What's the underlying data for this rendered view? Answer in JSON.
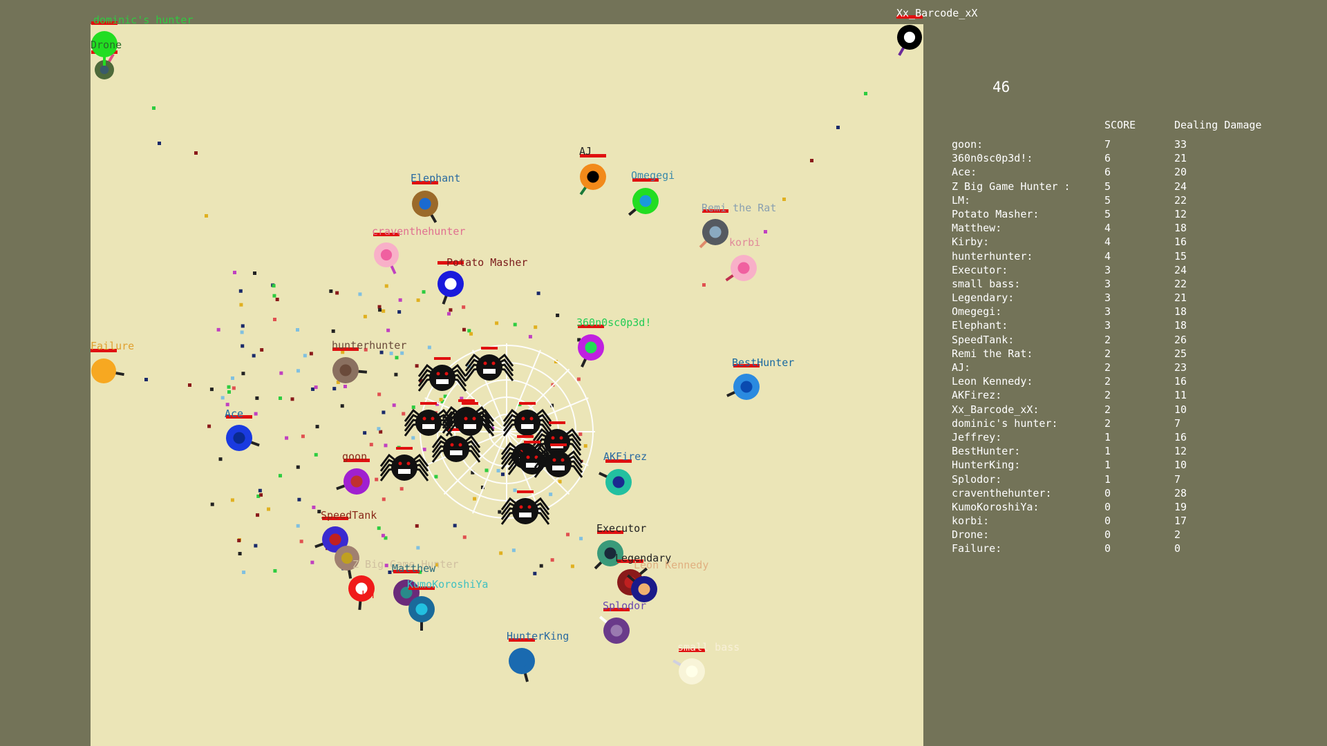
{
  "timer": "46",
  "scoreboard": {
    "headers": {
      "score": "SCORE",
      "damage": "Dealing Damage"
    },
    "rows": [
      {
        "name": "goon:",
        "score": "7",
        "damage": "33"
      },
      {
        "name": "360n0sc0p3d!:",
        "score": "6",
        "damage": "21"
      },
      {
        "name": "Ace:",
        "score": "6",
        "damage": "20"
      },
      {
        "name": "Z Big Game Hunter :",
        "score": "5",
        "damage": "24"
      },
      {
        "name": "LM:",
        "score": "5",
        "damage": "22"
      },
      {
        "name": "Potato Masher:",
        "score": "5",
        "damage": "12"
      },
      {
        "name": "Matthew:",
        "score": "4",
        "damage": "18"
      },
      {
        "name": "Kirby:",
        "score": "4",
        "damage": "16"
      },
      {
        "name": "hunterhunter:",
        "score": "4",
        "damage": "15"
      },
      {
        "name": "Executor:",
        "score": "3",
        "damage": "24"
      },
      {
        "name": "small bass:",
        "score": "3",
        "damage": "22"
      },
      {
        "name": "Legendary:",
        "score": "3",
        "damage": "21"
      },
      {
        "name": "Omegegi:",
        "score": "3",
        "damage": "18"
      },
      {
        "name": "Elephant:",
        "score": "3",
        "damage": "18"
      },
      {
        "name": "SpeedTank:",
        "score": "2",
        "damage": "26"
      },
      {
        "name": "Remi the Rat:",
        "score": "2",
        "damage": "25"
      },
      {
        "name": "AJ:",
        "score": "2",
        "damage": "23"
      },
      {
        "name": "Leon Kennedy:",
        "score": "2",
        "damage": "16"
      },
      {
        "name": "AKFirez:",
        "score": "2",
        "damage": "11"
      },
      {
        "name": "Xx_Barcode_xX:",
        "score": "2",
        "damage": "10"
      },
      {
        "name": "dominic's hunter:",
        "score": "2",
        "damage": "7"
      },
      {
        "name": "Jeffrey:",
        "score": "1",
        "damage": "16"
      },
      {
        "name": "BestHunter:",
        "score": "1",
        "damage": "12"
      },
      {
        "name": "HunterKing:",
        "score": "1",
        "damage": "10"
      },
      {
        "name": "Splodor:",
        "score": "1",
        "damage": "7"
      },
      {
        "name": "craventhehunter:",
        "score": "0",
        "damage": "28"
      },
      {
        "name": "KumoKoroshiYa:",
        "score": "0",
        "damage": "19"
      },
      {
        "name": "korbi:",
        "score": "0",
        "damage": "17"
      },
      {
        "name": "Drone:",
        "score": "0",
        "damage": "2"
      },
      {
        "name": "Failure:",
        "score": "0",
        "damage": "0"
      }
    ]
  },
  "players": [
    {
      "name": "dominic's hunter",
      "body": "#4e6a3a",
      "core": "#3a5a6a",
      "barrel": "#e05080",
      "label_color": "#2ecc40"
    },
    {
      "name": "Drone",
      "body": "#22dd22",
      "core": "#22dd22",
      "barrel": "#22dd22",
      "label_color": "#2a6a2a"
    },
    {
      "name": "Xx_Barcode_xX",
      "body": "#000000",
      "core": "#ffffff",
      "barrel": "#6a2a9a",
      "label_color": "#ffffff"
    },
    {
      "name": "AJ",
      "body": "#f28a1a",
      "core": "#000000",
      "barrel": "#1a7a3a",
      "label_color": "#222222"
    },
    {
      "name": "Elephant",
      "body": "#9b6a2a",
      "core": "#1a6ad0",
      "barrel": "#222222",
      "label_color": "#2a6aa0"
    },
    {
      "name": "Omegegi",
      "body": "#22dd22",
      "core": "#1a9adc",
      "barrel": "#222222",
      "label_color": "#3a8aaa"
    },
    {
      "name": "Remi the Rat",
      "body": "#555a60",
      "core": "#8aaac0",
      "barrel": "#e08a6a",
      "label_color": "#8aa0b0"
    },
    {
      "name": "craventhehunter",
      "body": "#f8b0c8",
      "core": "#f060a0",
      "barrel": "#c040c0",
      "label_color": "#e07090"
    },
    {
      "name": "korbi",
      "body": "#f8b0c8",
      "core": "#f060a0",
      "barrel": "#c03050",
      "label_color": "#e08a9a"
    },
    {
      "name": "Potato Masher",
      "body": "#1a1adc",
      "core": "#ffffff",
      "barrel": "#222222",
      "label_color": "#7a1a1a"
    },
    {
      "name": "360n0sc0p3d!",
      "body": "#c020e0",
      "core": "#22dd55",
      "barrel": "#222222",
      "label_color": "#22cc55"
    },
    {
      "name": "Failure",
      "body": "#f7a821",
      "core": "#f7a821",
      "barrel": "#222222",
      "label_color": "#e0a030"
    },
    {
      "name": "hunterhunter",
      "body": "#8a7060",
      "core": "#6a4a3a",
      "barrel": "#222222",
      "label_color": "#6a4a3a"
    },
    {
      "name": "BestHunter",
      "body": "#2a8ae0",
      "core": "#0a4ab0",
      "barrel": "#222222",
      "label_color": "#1a6aa0"
    },
    {
      "name": "Ace",
      "body": "#1a3ae0",
      "core": "#0a2a90",
      "barrel": "#222222",
      "label_color": "#1a6aa0"
    },
    {
      "name": "goon",
      "body": "#a020d0",
      "core": "#c03030",
      "barrel": "#222222",
      "label_color": "#8a2a1a"
    },
    {
      "name": "AKFirez",
      "body": "#22c0a0",
      "core": "#1a2a90",
      "barrel": "#222222",
      "label_color": "#2a6aa0"
    },
    {
      "name": "SpeedTank",
      "body": "#3a2ad0",
      "core": "#c02020",
      "barrel": "#222222",
      "label_color": "#8a2a1a"
    },
    {
      "name": "Z Big Game Hunter",
      "body": "#a08070",
      "core": "#c0a020",
      "barrel": "#222222",
      "label_color": "#d0c0a0"
    },
    {
      "name": "Executor",
      "body": "#3a9a7a",
      "core": "#1a2a3a",
      "barrel": "#222222",
      "label_color": "#222222"
    },
    {
      "name": "Legendary",
      "body": "#8a1a1a",
      "core": "#c02020",
      "barrel": "#222222",
      "label_color": "#222222"
    },
    {
      "name": "Leon Kennedy",
      "body": "#1a1a8a",
      "core": "#f0b070",
      "barrel": "#222222",
      "label_color": "#e0b080"
    },
    {
      "name": "Matthew",
      "body": "#6a2a7a",
      "core": "#2a8a8a",
      "barrel": "#e0c020",
      "label_color": "#2a6a7a"
    },
    {
      "name": "KumoKoroshiYa",
      "body": "#1a6a9a",
      "core": "#22c0e0",
      "barrel": "#222222",
      "label_color": "#40c0c0"
    },
    {
      "name": "LM",
      "body": "#f01a1a",
      "core": "#ffffff",
      "barrel": "#222222",
      "label_color": "#f01a1a"
    },
    {
      "name": "Splodor",
      "body": "#6a3a8a",
      "core": "#9a7ab0",
      "barrel": "#ffffff",
      "label_color": "#6a4ab0"
    },
    {
      "name": "HunterKing",
      "body": "#1a6ab0",
      "core": "#1a6ab0",
      "barrel": "#222222",
      "label_color": "#2a6aa0"
    },
    {
      "name": "small bass",
      "body": "#f8f4d8",
      "core": "#ffffe8",
      "barrel": "#d0d0e0",
      "label_color": "#f8f0d8"
    }
  ],
  "spiders": {
    "count": 13,
    "color": "#111111",
    "web_color": "#ffffff",
    "health_color": "#e01010"
  },
  "colors": {
    "background": "#737358",
    "arena": "#ebe5b7",
    "health": "#e01010",
    "scoreboard_text": "#ffffff"
  }
}
